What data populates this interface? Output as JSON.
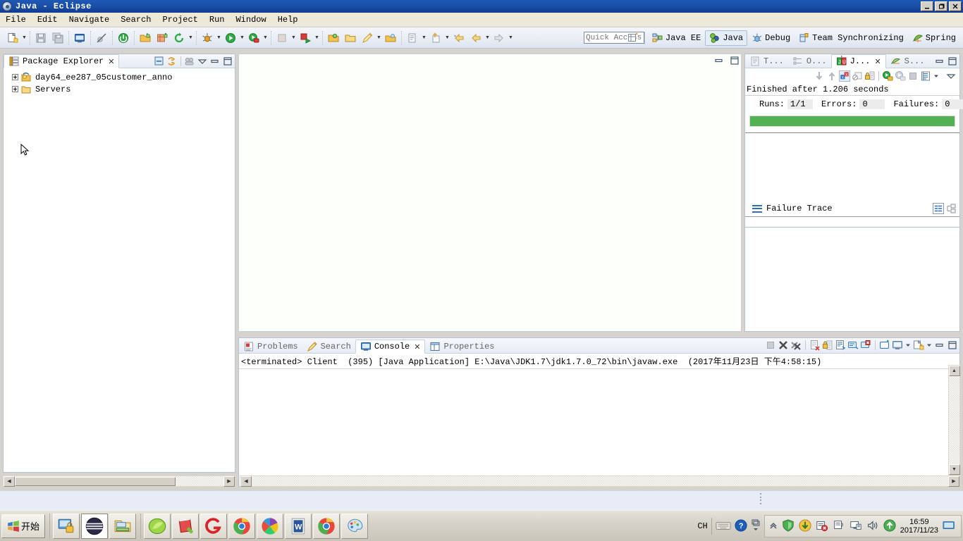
{
  "window": {
    "title": "Java - Eclipse",
    "icon": "eclipse-icon",
    "buttons": {
      "minimize": "_",
      "maximize": "❐",
      "close": "✕"
    }
  },
  "menubar": {
    "items": [
      "File",
      "Edit",
      "Navigate",
      "Search",
      "Project",
      "Run",
      "Window",
      "Help"
    ]
  },
  "toolbar": {
    "quick_access_placeholder": "Quick Access",
    "buttons": [
      {
        "name": "new-wizard-icon",
        "label": "New"
      },
      {
        "name": "save-icon",
        "label": "Save"
      },
      {
        "name": "save-all-icon",
        "label": "Save All"
      },
      {
        "name": "new-jsp-icon",
        "label": "New JSP"
      },
      {
        "name": "toggle-breakpoint-icon",
        "label": "Skip All Breakpoints"
      },
      {
        "name": "terminate-icon",
        "label": "Terminate"
      },
      {
        "name": "new-folder-icon",
        "label": "Open Task"
      },
      {
        "name": "new-class-icon",
        "label": "New Java Class"
      },
      {
        "name": "refresh-icon",
        "label": "Refresh"
      },
      {
        "name": "debug-icon",
        "label": "Debug"
      },
      {
        "name": "run-icon",
        "label": "Run"
      },
      {
        "name": "run-server-icon",
        "label": "Run on Server"
      },
      {
        "name": "stop-icon",
        "label": "Stop"
      },
      {
        "name": "publish-icon",
        "label": "Publish"
      },
      {
        "name": "open-type-icon",
        "label": "Open Type"
      },
      {
        "name": "open-task-icon",
        "label": "Open Task"
      },
      {
        "name": "search-icon",
        "label": "Search"
      },
      {
        "name": "open-perspective-icon",
        "label": "Open Perspective"
      },
      {
        "name": "next-annotation-icon",
        "label": "Next Annotation"
      },
      {
        "name": "previous-edit-icon",
        "label": "Previous Edit Location"
      },
      {
        "name": "back-icon",
        "label": "Back"
      },
      {
        "name": "forward-icon",
        "label": "Forward"
      }
    ]
  },
  "perspectives": {
    "open_perspective_label": "Open Perspective",
    "items": [
      {
        "name": "java-ee",
        "label": "Java EE",
        "active": false
      },
      {
        "name": "java",
        "label": "Java",
        "active": true
      },
      {
        "name": "debug",
        "label": "Debug",
        "active": false
      },
      {
        "name": "team-synchronizing",
        "label": "Team Synchronizing",
        "active": false
      },
      {
        "name": "spring",
        "label": "Spring",
        "active": false
      }
    ]
  },
  "package_explorer": {
    "tab_label": "Package Explorer",
    "close_glyph": "✕",
    "toolbar": [
      {
        "name": "collapse-all-icon",
        "label": "Collapse All"
      },
      {
        "name": "link-with-editor-icon",
        "label": "Link with Editor"
      },
      {
        "name": "view-menu-icon",
        "label": "View Menu"
      },
      {
        "name": "minimize-icon",
        "label": "Minimize"
      },
      {
        "name": "maximize-icon",
        "label": "Maximize"
      }
    ],
    "tree": [
      {
        "label": "day64_ee287_05customer_anno",
        "icon": "java-project-icon",
        "expanded": false
      },
      {
        "label": "Servers",
        "icon": "folder-icon",
        "expanded": false
      }
    ]
  },
  "editor": {
    "minimize_label": "Restore",
    "maximize_label": "Maximize"
  },
  "junit": {
    "tabs": [
      {
        "name": "tasks",
        "label": "T...",
        "active": false,
        "icon": "tasks-icon"
      },
      {
        "name": "outline",
        "label": "O...",
        "active": false,
        "icon": "outline-icon"
      },
      {
        "name": "junit",
        "label": "J...",
        "active": true,
        "icon": "junit-icon",
        "close": "✕"
      },
      {
        "name": "servers",
        "label": "S...",
        "active": false,
        "icon": "servers-icon"
      }
    ],
    "window_buttons": [
      {
        "name": "minimize-icon",
        "label": "Minimize"
      },
      {
        "name": "maximize-icon",
        "label": "Maximize"
      }
    ],
    "toolbar": [
      {
        "name": "next-failure-icon",
        "label": "Next Failed Test"
      },
      {
        "name": "previous-failure-icon",
        "label": "Previous Failed Test"
      },
      {
        "name": "show-failures-only-icon",
        "label": "Show Failures Only",
        "active": true
      },
      {
        "name": "show-ignored-icon",
        "label": "Show Tests in Ignored State"
      },
      {
        "name": "scroll-lock-icon",
        "label": "Scroll Lock"
      },
      {
        "name": "rerun-test-icon",
        "label": "Rerun Test"
      },
      {
        "name": "rerun-failed-icon",
        "label": "Rerun Test - Failures First"
      },
      {
        "name": "stop-icon",
        "label": "Stop JUnit Test Run"
      },
      {
        "name": "test-run-history-icon",
        "label": "Test Run History"
      },
      {
        "name": "dropdown-arrow-icon",
        "label": "Menu"
      },
      {
        "name": "view-menu-icon",
        "label": "View Menu"
      }
    ],
    "status_text": "Finished after 1.206 seconds",
    "counters": {
      "runs_label": "Runs:",
      "runs_value": "1/1",
      "errors_label": "Errors:",
      "errors_value": "0",
      "failures_label": "Failures:",
      "failures_value": "0"
    },
    "progress": {
      "percent": 100,
      "color": "#54b054"
    },
    "failure_trace": {
      "label": "Failure Trace",
      "tools": [
        {
          "name": "compare-result-icon",
          "label": "Compare Result"
        },
        {
          "name": "stack-filter-icon",
          "label": "Filter Stack Trace"
        }
      ]
    }
  },
  "console": {
    "tabs": [
      {
        "name": "problems",
        "label": "Problems",
        "active": false,
        "icon": "problems-icon"
      },
      {
        "name": "search",
        "label": "Search",
        "active": false,
        "icon": "search-icon"
      },
      {
        "name": "console",
        "label": "Console",
        "active": true,
        "icon": "console-icon",
        "close": "✕"
      },
      {
        "name": "properties",
        "label": "Properties",
        "active": false,
        "icon": "properties-icon"
      }
    ],
    "toolbar": [
      {
        "name": "terminate-icon",
        "label": "Terminate"
      },
      {
        "name": "remove-launch-icon",
        "label": "Remove Launch"
      },
      {
        "name": "remove-all-terminated-icon",
        "label": "Remove All Terminated Launches"
      },
      {
        "name": "clear-console-icon",
        "label": "Clear Console"
      },
      {
        "name": "scroll-lock-icon",
        "label": "Scroll Lock"
      },
      {
        "name": "word-wrap-icon",
        "label": "Word Wrap"
      },
      {
        "name": "show-console-icon",
        "label": "Show Console When Output Changes"
      },
      {
        "name": "pin-console-icon",
        "label": "Pin Console"
      },
      {
        "name": "open-console-icon",
        "label": "Open Console"
      },
      {
        "name": "display-selected-console-icon",
        "label": "Display Selected Console"
      },
      {
        "name": "console-dropdown-icon",
        "label": "Open Console Menu"
      },
      {
        "name": "new-console-icon",
        "label": "New Console View"
      },
      {
        "name": "minimize-icon",
        "label": "Minimize"
      },
      {
        "name": "maximize-icon",
        "label": "Maximize"
      }
    ],
    "header_line": "<terminated> Client  (395) [Java Application] E:\\Java\\JDK1.7\\jdk1.7.0_72\\bin\\javaw.exe  (2017年11月23日 下午4:58:15)",
    "output": ""
  },
  "taskbar": {
    "start_label": "开始",
    "quick_launch": [
      {
        "name": "show-desktop-icon",
        "label": "Show Desktop"
      },
      {
        "name": "browser-dark-icon",
        "label": "Browser",
        "selected": true
      },
      {
        "name": "explorer-icon",
        "label": "Windows Explorer"
      }
    ],
    "apps": [
      {
        "name": "app-green-leaf-icon",
        "label": "Green App"
      },
      {
        "name": "app-notepad-plus-icon",
        "label": "Notepad++"
      },
      {
        "name": "app-qq-game-icon",
        "label": "QQ Game"
      },
      {
        "name": "app-chrome-icon",
        "label": "Chrome"
      },
      {
        "name": "app-color-browser-icon",
        "label": "360 Browser"
      },
      {
        "name": "app-word-icon",
        "label": "Microsoft Word"
      },
      {
        "name": "app-chrome-2-icon",
        "label": "Chrome"
      },
      {
        "name": "app-paint-icon",
        "label": "Paint"
      }
    ],
    "tray": {
      "ime_label": "CH",
      "icons": [
        {
          "name": "keyboard-icon",
          "label": "Keyboard"
        },
        {
          "name": "help-icon",
          "label": "Help"
        },
        {
          "name": "window-switch-icon",
          "label": "Switch Window"
        },
        {
          "name": "show-hidden-icons-icon",
          "label": "Show hidden icons"
        },
        {
          "name": "shield-green-icon",
          "label": "Security"
        },
        {
          "name": "download-icon",
          "label": "Downloader"
        },
        {
          "name": "remove-device-icon",
          "label": "Safely Remove Hardware"
        },
        {
          "name": "network-icon",
          "label": "Network"
        },
        {
          "name": "monitor-icon",
          "label": "Display"
        },
        {
          "name": "volume-icon",
          "label": "Volume"
        },
        {
          "name": "update-icon",
          "label": "Update"
        }
      ],
      "clock_time": "16:59",
      "clock_date": "2017/11/23",
      "show-desktop": "Show Desktop"
    }
  }
}
